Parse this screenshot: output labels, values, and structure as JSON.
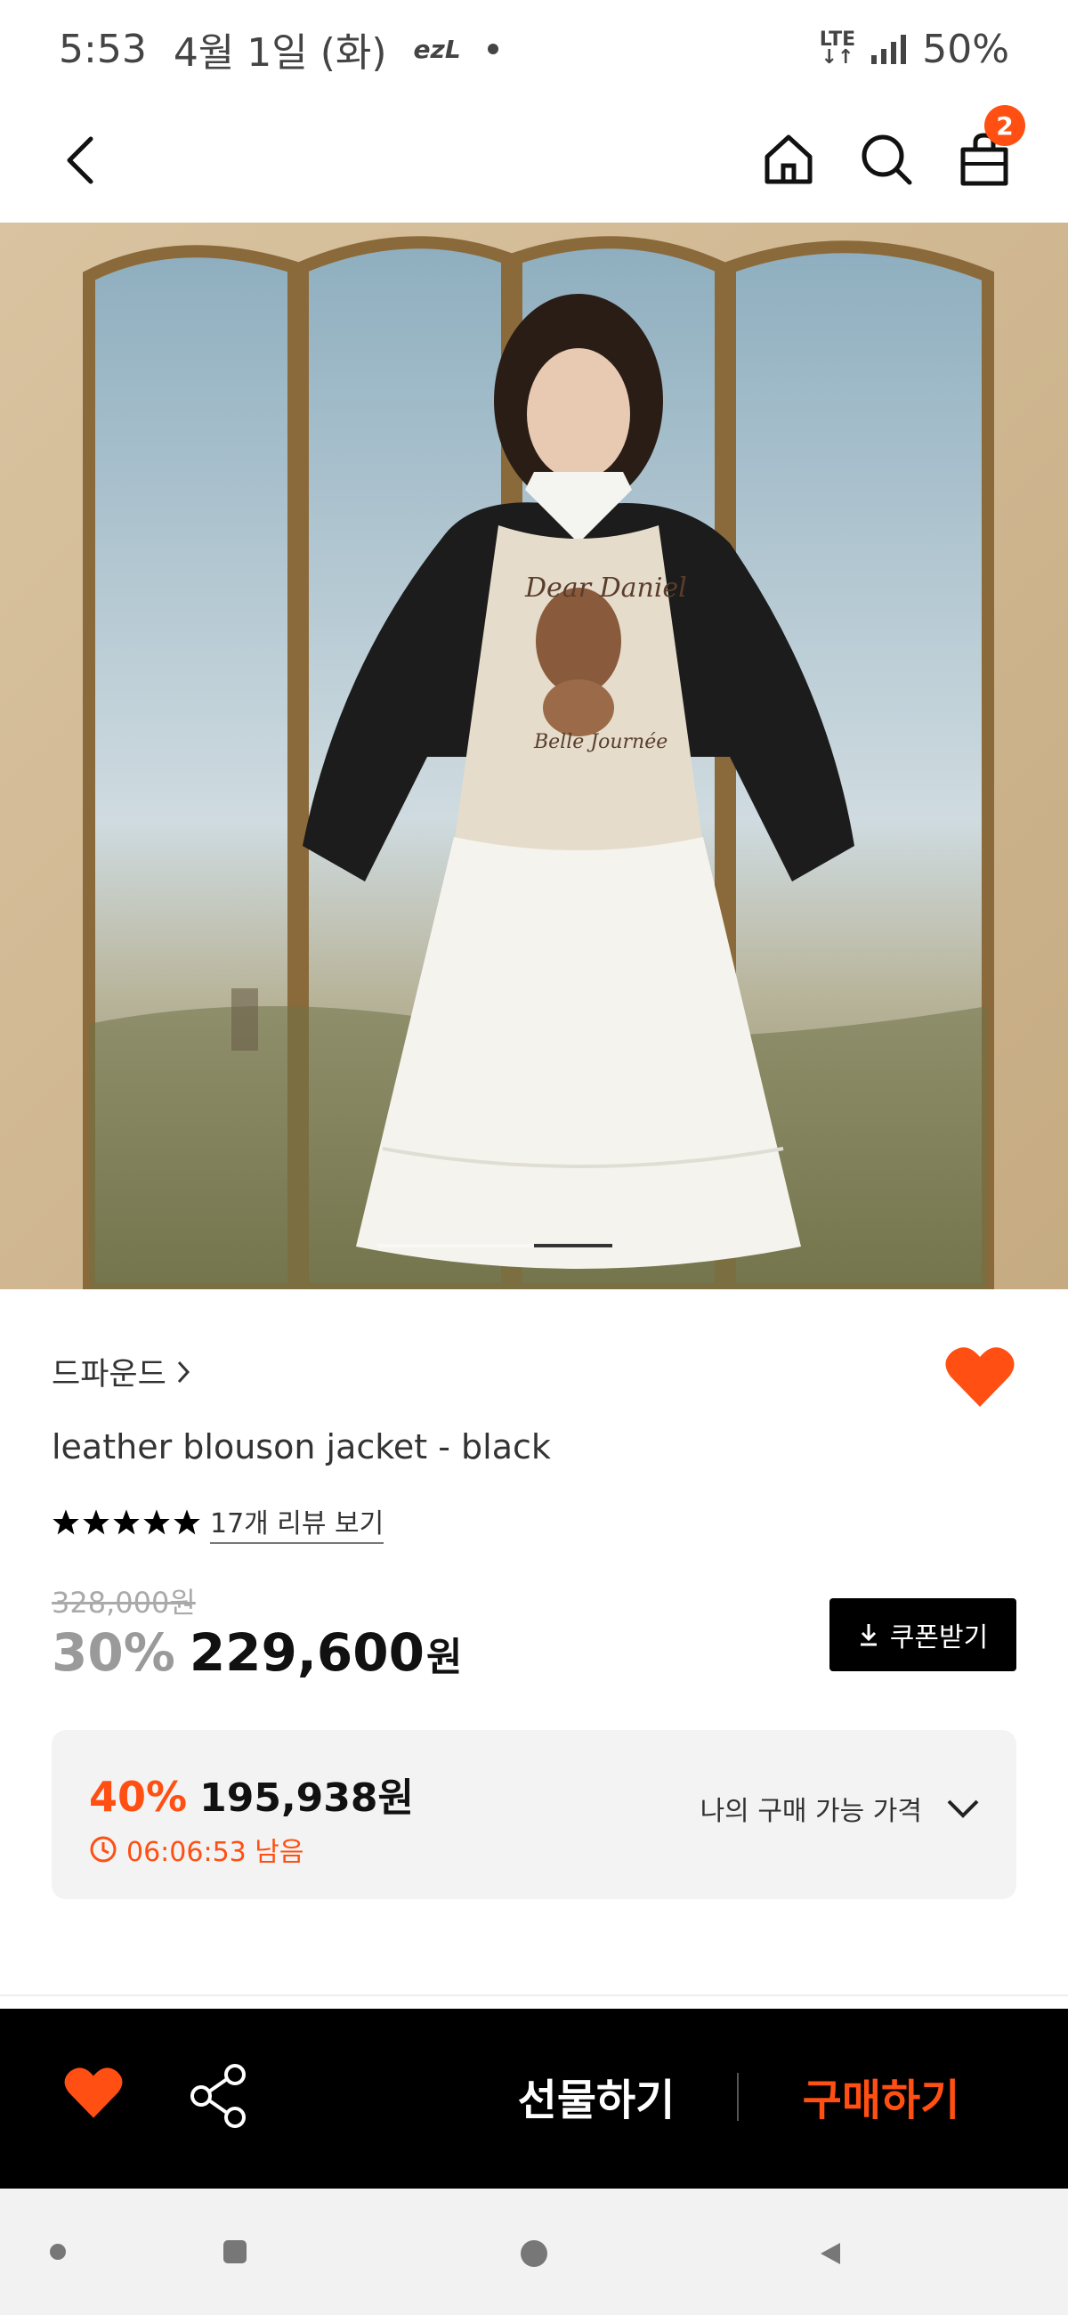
{
  "status_bar": {
    "time": "5:53",
    "date": "4월 1일 (화)",
    "app_indicator": "ezL",
    "network": "LTE",
    "battery": "50%"
  },
  "top_bar": {
    "cart_count": "2",
    "icons": [
      "back-arrow-icon",
      "home-icon",
      "search-icon",
      "shopping-bag-icon"
    ]
  },
  "product": {
    "brand": "드파운드",
    "name": "leather blouson jacket - black",
    "rating_stars": 5,
    "review_link": "17개 리뷰 보기",
    "original_price": "328,000원",
    "discount_rate": "30%",
    "sale_price": "229,600",
    "currency": "원",
    "coupon_label": "쿠폰받기",
    "wishlisted": true,
    "image_carousel": {
      "slide_count": 3,
      "current_index": 3
    }
  },
  "my_price": {
    "discount_rate": "40%",
    "price": "195,938원",
    "timer": "06:06:53 남음",
    "toggle_label": "나의 구매 가능 가격"
  },
  "purchase_bar": {
    "gift_label": "선물하기",
    "buy_label": "구매하기"
  },
  "colors": {
    "accent": "#ff4f12",
    "bar_background": "#000000",
    "box_background": "#f3f3f3"
  }
}
